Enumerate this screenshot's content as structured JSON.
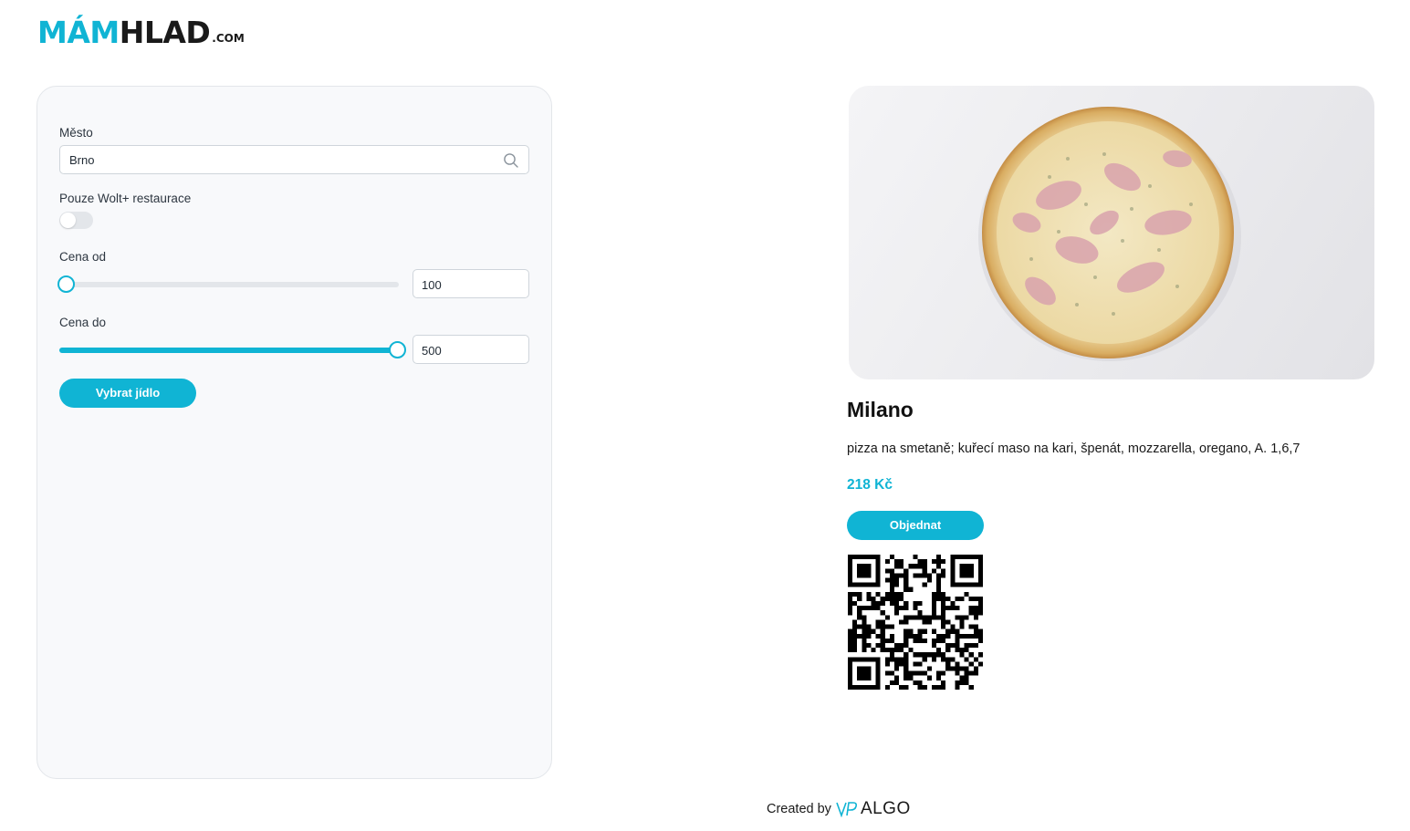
{
  "brand": {
    "part1": "MÁM",
    "part2": "HLAD",
    "suffix": ".COM"
  },
  "filters": {
    "city_label": "Město",
    "city_value": "Brno",
    "wolt_label": "Pouze Wolt+ restaurace",
    "wolt_enabled": false,
    "price_from_label": "Cena od",
    "price_from_value": "100",
    "price_from_level": 0,
    "price_to_label": "Cena do",
    "price_to_value": "500",
    "price_to_level": 1,
    "select_button": "Vybrat jídlo"
  },
  "dish": {
    "name": "Milano",
    "description": "pizza na smetaně; kuřecí maso na kari, špenát, mozzarella, oregano, A. 1,6,7",
    "price": "218 Kč",
    "order_button": "Objednat",
    "image_icon": "pizza-photo",
    "qr_icon": "qr-code"
  },
  "footer": {
    "created_by": "Created by",
    "company_mark": "VP",
    "company_name": "ALGO"
  },
  "colors": {
    "accent": "#10b4d4",
    "panel_bg": "#f8f9fb",
    "text": "#1a1a1a"
  }
}
